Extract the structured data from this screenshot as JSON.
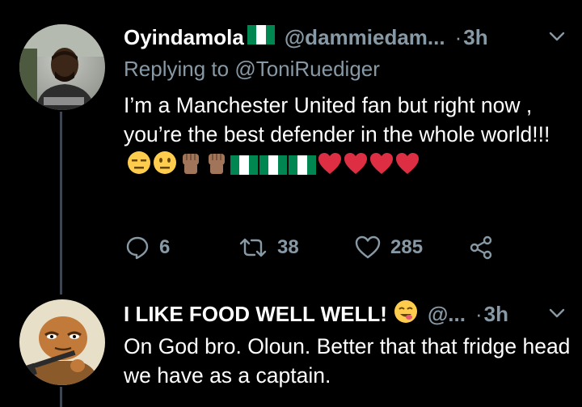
{
  "tweets": [
    {
      "display_name": "Oyindamola",
      "name_flag": "Nigeria flag",
      "handle": "@dammiedam...",
      "separator": "·",
      "time": "3h",
      "replying_prefix": "Replying to ",
      "replying_to": "@ToniRuediger",
      "text": "I’m a Manchester United fan but right now , you’re the best defender in the whole world!!!",
      "emojis": [
        "expressionless",
        "neutral-face",
        "raised-fist",
        "raised-fist",
        "nigeria-flag",
        "nigeria-flag",
        "nigeria-flag",
        "red-heart",
        "red-heart",
        "red-heart",
        "red-heart"
      ],
      "actions": {
        "reply_count": "6",
        "retweet_count": "38",
        "like_count": "285"
      }
    },
    {
      "display_name": "I LIKE FOOD WELL WELL!",
      "name_emoji": "face-savoring-food",
      "handle": "@...",
      "separator": "·",
      "time": "3h",
      "text": "On God bro. Oloun. Better that that fridge head we have as a captain."
    }
  ],
  "colors": {
    "background": "#000000",
    "primary_text": "#ffffff",
    "secondary_text": "#8899a6",
    "thread_line": "#3d4650",
    "heart": "#dd2e44",
    "flag_green": "#008751"
  },
  "icons": [
    "reply-icon",
    "retweet-icon",
    "like-icon",
    "share-icon",
    "chevron-down-icon"
  ]
}
